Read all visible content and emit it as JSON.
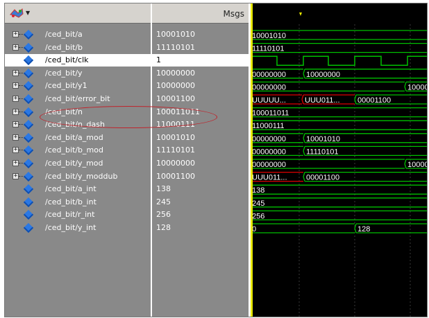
{
  "header": {
    "msgs_label": "Msgs",
    "icon": "wave-window-icon"
  },
  "signals": [
    {
      "name": "/ced_bit/a",
      "value": "10001010",
      "expandable": true,
      "selected": false
    },
    {
      "name": "/ced_bit/b",
      "value": "11110101",
      "expandable": true,
      "selected": false
    },
    {
      "name": "/ced_bit/clk",
      "value": "1",
      "expandable": false,
      "selected": true
    },
    {
      "name": "/ced_bit/y",
      "value": "10000000",
      "expandable": true,
      "selected": false
    },
    {
      "name": "/ced_bit/y1",
      "value": "10000000",
      "expandable": true,
      "selected": false
    },
    {
      "name": "/ced_bit/error_bit",
      "value": "10001100",
      "expandable": true,
      "selected": false
    },
    {
      "name": "/ced_bit/n",
      "value": "100011011",
      "expandable": true,
      "selected": false
    },
    {
      "name": "/ced_bit/n_dash",
      "value": "11000111",
      "expandable": true,
      "selected": false
    },
    {
      "name": "/ced_bit/a_mod",
      "value": "10001010",
      "expandable": true,
      "selected": false
    },
    {
      "name": "/ced_bit/b_mod",
      "value": "11110101",
      "expandable": true,
      "selected": false
    },
    {
      "name": "/ced_bit/y_mod",
      "value": "10000000",
      "expandable": true,
      "selected": false
    },
    {
      "name": "/ced_bit/y_moddub",
      "value": "10001100",
      "expandable": true,
      "selected": false
    },
    {
      "name": "/ced_bit/a_int",
      "value": "138",
      "expandable": false,
      "selected": false
    },
    {
      "name": "/ced_bit/b_int",
      "value": "245",
      "expandable": false,
      "selected": false
    },
    {
      "name": "/ced_bit/r_int",
      "value": "256",
      "expandable": false,
      "selected": false
    },
    {
      "name": "/ced_bit/y_int",
      "value": "128",
      "expandable": false,
      "selected": false
    }
  ],
  "waveform": {
    "a": [
      "10001010"
    ],
    "b": [
      "11110101"
    ],
    "y": [
      "00000000",
      "10000000"
    ],
    "y1": [
      "00000000",
      "10000"
    ],
    "error_bit": [
      "UUUUU...",
      "UUU011...",
      "00001100"
    ],
    "n": [
      "100011011"
    ],
    "n_dash": [
      "11000111"
    ],
    "a_mod": [
      "00000000",
      "10001010"
    ],
    "b_mod": [
      "00000000",
      "11110101"
    ],
    "y_mod": [
      "00000000",
      "10000"
    ],
    "y_moddub": [
      "UUU011...",
      "00001100"
    ],
    "a_int": [
      "138"
    ],
    "b_int": [
      "245"
    ],
    "r_int": [
      "256"
    ],
    "y_int": [
      "0",
      "128"
    ]
  },
  "colors": {
    "signal_green": "#00c000",
    "undefined_red": "#e00000",
    "cursor_yellow": "#e8e800",
    "wave_bg": "#000000",
    "panel_gray": "#898989"
  }
}
